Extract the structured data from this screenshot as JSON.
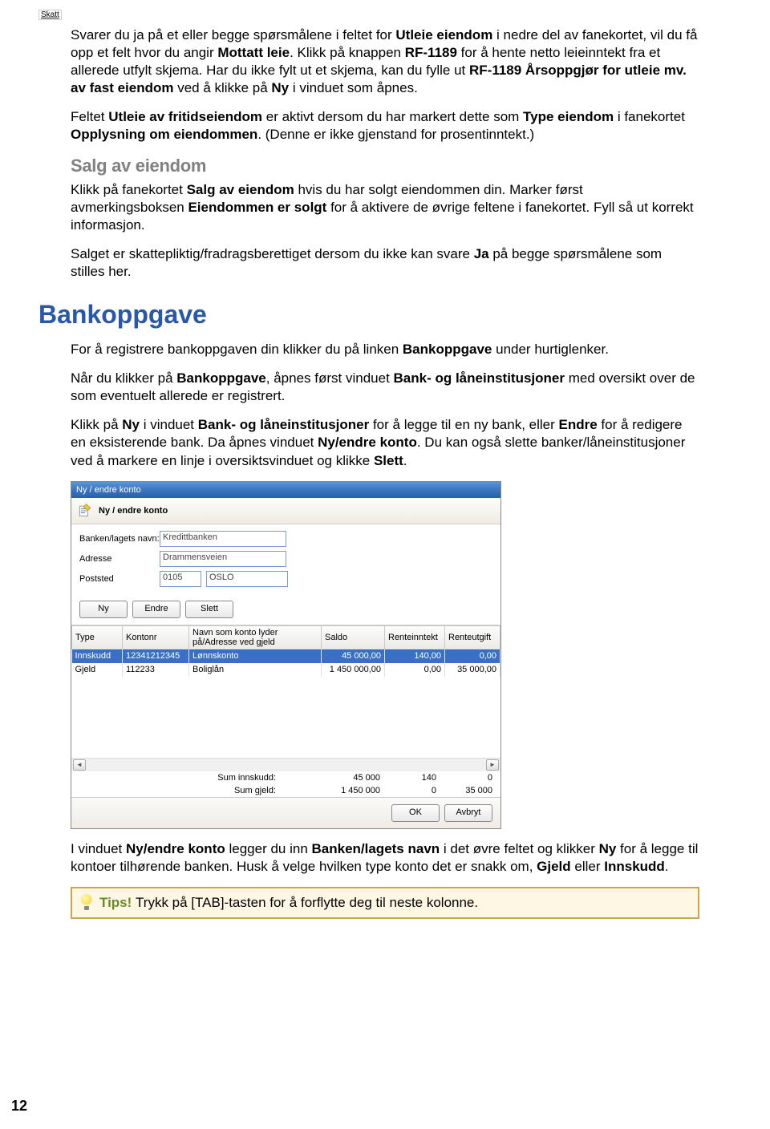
{
  "header_tag": "Skatt",
  "intro": {
    "p1_a": "Svarer du ja på et eller begge spørsmålene i feltet for ",
    "p1_b": "Utleie eiendom",
    "p1_c": " i nedre del av fanekortet, vil du få opp et felt hvor du angir ",
    "p1_d": "Mottatt leie",
    "p1_e": ". Klikk på knappen ",
    "p1_f": "RF-1189",
    "p1_g": " for å hente netto leieinntekt fra et allerede utfylt skjema. Har du ikke fylt ut et skjema, kan du fylle ut ",
    "p1_h": "RF-1189 Årsoppgjør for utleie mv. av fast eiendom",
    "p1_i": " ved å klikke på ",
    "p1_j": "Ny",
    "p1_k": " i vinduet som åpnes.",
    "p2_a": "Feltet ",
    "p2_b": "Utleie av fritidseiendom",
    "p2_c": " er aktivt dersom du har markert dette som ",
    "p2_d": "Type eiendom",
    "p2_e": " i fanekortet ",
    "p2_f": "Opplysning om eiendommen",
    "p2_g": ". (Denne er ikke gjenstand for prosentinntekt.)"
  },
  "salg": {
    "heading": "Salg av eiendom",
    "p1_a": "Klikk på fanekortet ",
    "p1_b": "Salg av eiendom",
    "p1_c": " hvis du har solgt eiendommen din. Marker først avmerkingsboksen ",
    "p1_d": "Eiendommen er solgt",
    "p1_e": " for å aktivere de øvrige feltene i fanekortet. Fyll så ut korrekt informasjon.",
    "p2_a": "Salget er skattepliktig/fradragsberettiget dersom du ikke kan svare ",
    "p2_b": "Ja",
    "p2_c": " på begge spørsmålene som stilles her."
  },
  "bank": {
    "heading": "Bankoppgave",
    "p1_a": "For å registrere bankoppgaven din klikker du på linken ",
    "p1_b": "Bankoppgave",
    "p1_c": " under hurtiglenker.",
    "p2_a": "Når du klikker på ",
    "p2_b": "Bankoppgave",
    "p2_c": ", åpnes først vinduet ",
    "p2_d": "Bank- og låneinstitusjoner",
    "p2_e": " med oversikt over de som eventuelt allerede er registrert.",
    "p3_a": "Klikk på ",
    "p3_b": "Ny",
    "p3_c": " i vinduet ",
    "p3_d": "Bank- og låneinstitusjoner",
    "p3_e": " for å legge til en ny bank, eller ",
    "p3_f": "Endre",
    "p3_g": " for å redigere en eksisterende bank. Da åpnes vinduet ",
    "p3_h": "Ny/endre konto",
    "p3_i": ". Du kan også slette banker/låneinstitusjoner ved å markere en linje i oversiktsvinduet og klikke ",
    "p3_j": "Slett",
    "p3_k": ".",
    "p4_a": "I vinduet ",
    "p4_b": "Ny/endre konto",
    "p4_c": " legger du inn ",
    "p4_d": "Banken/lagets navn",
    "p4_e": " i det øvre feltet og klikker ",
    "p4_f": "Ny",
    "p4_g": " for å legge til kontoer tilhørende banken. Husk å velge hvilken type konto det er snakk om, ",
    "p4_h": "Gjeld",
    "p4_i": " eller ",
    "p4_j": "Innskudd",
    "p4_k": "."
  },
  "dialog": {
    "title": "Ny / endre konto",
    "header_label": "Ny / endre konto",
    "labels": {
      "bank_name": "Banken/lagets navn:",
      "address": "Adresse",
      "poststed": "Poststed"
    },
    "values": {
      "bank_name": "Kredittbanken",
      "address": "Drammensveien",
      "postnr": "0105",
      "poststed": "OSLO"
    },
    "buttons": {
      "ny": "Ny",
      "endre": "Endre",
      "slett": "Slett",
      "ok": "OK",
      "avbryt": "Avbryt"
    },
    "columns": [
      "Type",
      "Kontonr",
      "Navn som konto lyder på/Adresse ved gjeld",
      "Saldo",
      "Renteinntekt",
      "Renteutgift"
    ],
    "rows": [
      {
        "type": "Innskudd",
        "kontonr": "12341212345",
        "navn": "Lønnskonto",
        "saldo": "45 000,00",
        "renteinn": "140,00",
        "renteut": "0,00"
      },
      {
        "type": "Gjeld",
        "kontonr": "112233",
        "navn": "Boliglån",
        "saldo": "1 450 000,00",
        "renteinn": "0,00",
        "renteut": "35 000,00"
      }
    ],
    "sums": {
      "label_innskudd": "Sum innskudd:",
      "label_gjeld": "Sum gjeld:",
      "innskudd": [
        "45 000",
        "140",
        "0"
      ],
      "gjeld": [
        "1 450 000",
        "0",
        "35 000"
      ]
    }
  },
  "tip": {
    "label": "Tips! ",
    "text": "Trykk på [TAB]-tasten for å forflytte deg til neste kolonne."
  },
  "page_number": "12"
}
